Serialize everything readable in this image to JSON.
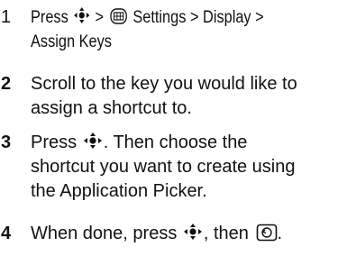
{
  "steps": [
    {
      "number": "1",
      "parts": [
        "Press",
        ">",
        "Settings > Display >",
        "Assign Keys"
      ]
    },
    {
      "number": "2",
      "lines": [
        "Scroll to the key you would like to",
        "assign a shortcut to."
      ]
    },
    {
      "number": "3",
      "parts": [
        "Press",
        ". Then choose the",
        "shortcut you want to create using",
        "the Application Picker."
      ]
    },
    {
      "number": "4",
      "parts": [
        "When done, press",
        ", then",
        "."
      ]
    }
  ],
  "icons": {
    "nav_key": "navigation-center-key-icon",
    "menu_key": "menu-key-icon",
    "back_key": "back-key-icon"
  }
}
